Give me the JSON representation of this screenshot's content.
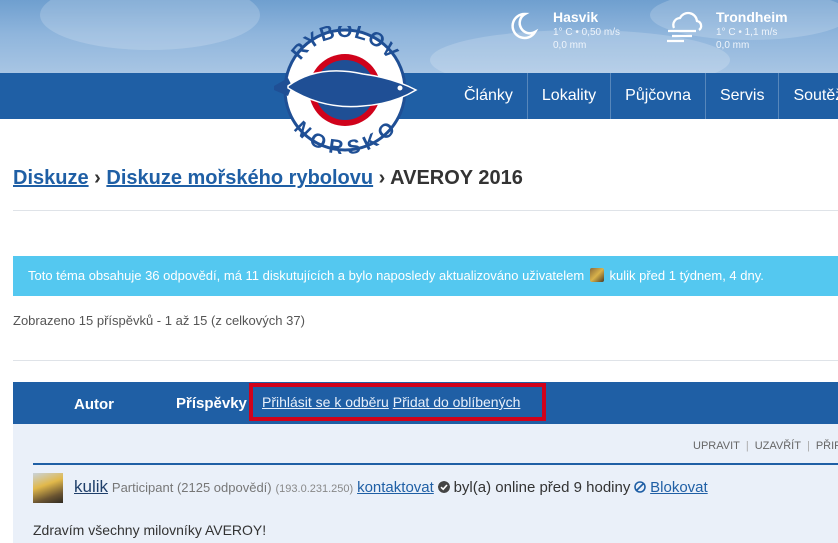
{
  "weather": [
    {
      "icon": "moon-icon",
      "city": "Hasvik",
      "details": "1° C • 0,50 m/s",
      "precip": "0,0 mm"
    },
    {
      "icon": "cloud-wind-icon",
      "city": "Trondheim",
      "details": "1° C • 1,1 m/s",
      "precip": "0,0 mm"
    }
  ],
  "logo": {
    "top_text": "RYBOLOV",
    "bottom_text": "NORSKO"
  },
  "nav": [
    "Články",
    "Lokality",
    "Půjčovna",
    "Servis",
    "Soutěž"
  ],
  "breadcrumb": {
    "crumb1": "Diskuze",
    "sep1": " › ",
    "crumb2": "Diskuze mořského rybolovu",
    "current": " › AVEROY 2016"
  },
  "info": {
    "text_before": "Toto téma obsahuje 36 odpovědí, má 11 diskutujících a bylo naposledy aktualizováno uživatelem",
    "user": "kulik",
    "text_after": "před 1 týdnem, 4 dny."
  },
  "shown_text": "Zobrazeno 15 příspěvků - 1 až 15 (z celkových 37)",
  "table_header": {
    "author": "Autor",
    "posts": "Příspěvky",
    "subscribe": "Přihlásit se k odběru",
    "favorite": "Přidat do oblíbených"
  },
  "admin_links": [
    "UPRAVIT",
    "UZAVŘÍT",
    "PŘIPNOUT"
  ],
  "post": {
    "author": "kulik",
    "role": "Participant (2125 odpovědí)",
    "ip": "(193.0.231.250)",
    "contact": "kontaktovat",
    "online": "byl(a) online před 9 hodiny",
    "block": "Blokovat",
    "text": "Zdravím všechny milovníky AVEROY!"
  },
  "colors": {
    "nav_blue": "#1f5fa5",
    "info_cyan": "#54c8f0",
    "highlight_red": "#d0021b"
  }
}
